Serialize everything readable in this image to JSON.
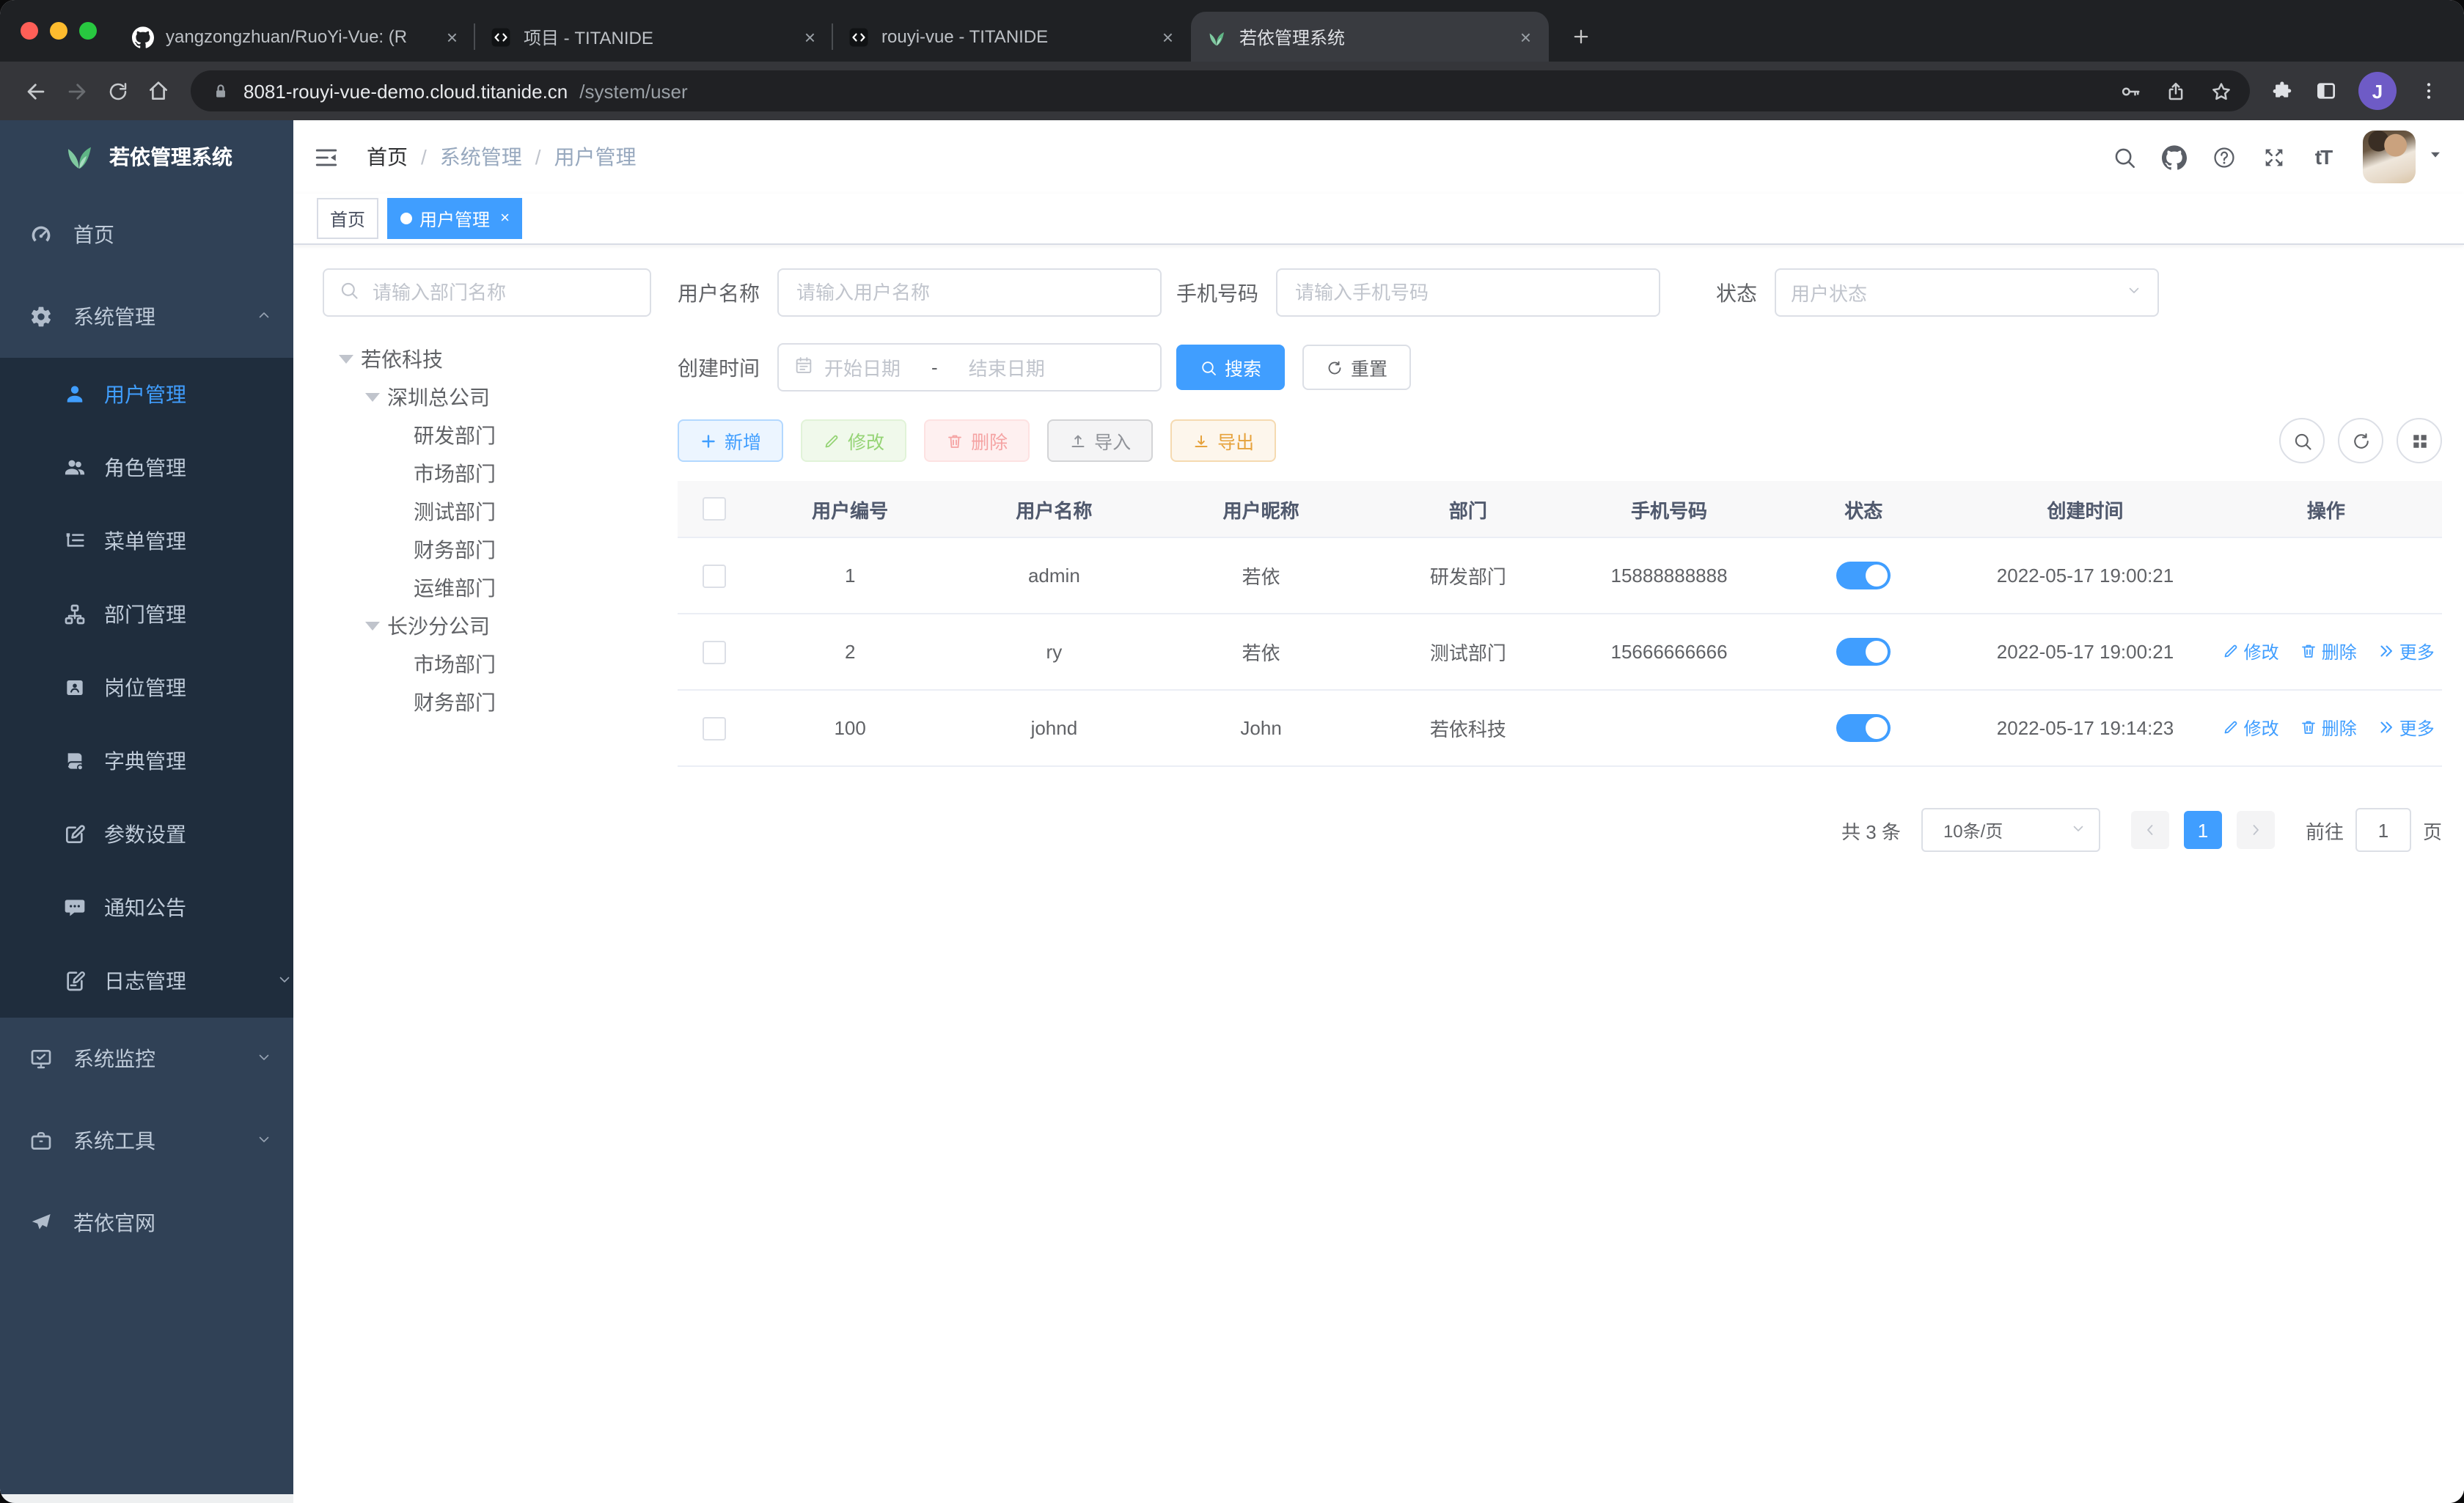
{
  "window": {
    "traffic_lights": [
      "#ff5f57",
      "#febc2e",
      "#28c840"
    ]
  },
  "browser": {
    "tabs": [
      {
        "title": "yangzongzhuan/RuoYi-Vue: (R",
        "icon": "github",
        "active": false
      },
      {
        "title": "项目 - TITANIDE",
        "icon": "code",
        "active": false
      },
      {
        "title": "rouyi-vue - TITANIDE",
        "icon": "code",
        "active": false
      },
      {
        "title": "若依管理系统",
        "icon": "leaf",
        "active": true
      }
    ],
    "url": {
      "host": "8081-rouyi-vue-demo.cloud.titanide.cn",
      "path": "/system/user"
    },
    "profile_initial": "J",
    "omnibox_icons": [
      "key",
      "share",
      "star"
    ],
    "toolbar_icons": [
      "puzzle",
      "side-panel",
      "kebab-menu"
    ]
  },
  "sidebar": {
    "logo_title": "若依管理系统",
    "menu": [
      {
        "label": "首页",
        "icon": "dashboard"
      },
      {
        "label": "系统管理",
        "icon": "gear",
        "state": "expanded",
        "children": [
          {
            "label": "用户管理",
            "icon": "user",
            "active": true
          },
          {
            "label": "角色管理",
            "icon": "users"
          },
          {
            "label": "菜单管理",
            "icon": "menu-tree"
          },
          {
            "label": "部门管理",
            "icon": "org-tree"
          },
          {
            "label": "岗位管理",
            "icon": "badge"
          },
          {
            "label": "字典管理",
            "icon": "dictionary"
          },
          {
            "label": "参数设置",
            "icon": "edit-square"
          },
          {
            "label": "通知公告",
            "icon": "message"
          },
          {
            "label": "日志管理",
            "icon": "log",
            "state": "collapsed"
          }
        ]
      },
      {
        "label": "系统监控",
        "icon": "monitor",
        "state": "collapsed"
      },
      {
        "label": "系统工具",
        "icon": "toolbox",
        "state": "collapsed"
      },
      {
        "label": "若依官网",
        "icon": "paper-plane"
      }
    ]
  },
  "navbar": {
    "breadcrumb": [
      "首页",
      "系统管理",
      "用户管理"
    ],
    "action_icons": [
      "search",
      "github",
      "question",
      "fullscreen",
      "text-size"
    ]
  },
  "tags": [
    {
      "label": "首页",
      "active": false,
      "closable": false
    },
    {
      "label": "用户管理",
      "active": true,
      "closable": true
    }
  ],
  "dept": {
    "search_placeholder": "请输入部门名称",
    "tree": [
      {
        "label": "若依科技",
        "expanded": true,
        "children": [
          {
            "label": "深圳总公司",
            "expanded": true,
            "children": [
              {
                "label": "研发部门"
              },
              {
                "label": "市场部门"
              },
              {
                "label": "测试部门"
              },
              {
                "label": "财务部门"
              },
              {
                "label": "运维部门"
              }
            ]
          },
          {
            "label": "长沙分公司",
            "expanded": true,
            "children": [
              {
                "label": "市场部门"
              },
              {
                "label": "财务部门"
              }
            ]
          }
        ]
      }
    ]
  },
  "filters": {
    "username_label": "用户名称",
    "username_placeholder": "请输入用户名称",
    "phone_label": "手机号码",
    "phone_placeholder": "请输入手机号码",
    "status_label": "状态",
    "status_placeholder": "用户状态",
    "created_label": "创建时间",
    "date_start_placeholder": "开始日期",
    "date_separator": "-",
    "date_end_placeholder": "结束日期",
    "search_button": "搜索",
    "reset_button": "重置"
  },
  "toolbar": {
    "buttons": [
      {
        "label": "新增",
        "icon": "plus",
        "type": "primary"
      },
      {
        "label": "修改",
        "icon": "pencil",
        "type": "success"
      },
      {
        "label": "删除",
        "icon": "trash",
        "type": "danger"
      },
      {
        "label": "导入",
        "icon": "upload",
        "type": "info"
      },
      {
        "label": "导出",
        "icon": "download",
        "type": "warning"
      }
    ],
    "right_icons": [
      "search",
      "refresh",
      "grid"
    ]
  },
  "table": {
    "columns": [
      "用户编号",
      "用户名称",
      "用户昵称",
      "部门",
      "手机号码",
      "状态",
      "创建时间",
      "操作"
    ],
    "rows": [
      {
        "id": "1",
        "username": "admin",
        "nickname": "若依",
        "dept": "研发部门",
        "phone": "15888888888",
        "status": true,
        "created": "2022-05-17 19:00:21",
        "actions": false
      },
      {
        "id": "2",
        "username": "ry",
        "nickname": "若依",
        "dept": "测试部门",
        "phone": "15666666666",
        "status": true,
        "created": "2022-05-17 19:00:21",
        "actions": true
      },
      {
        "id": "100",
        "username": "johnd",
        "nickname": "John",
        "dept": "若依科技",
        "phone": "",
        "status": true,
        "created": "2022-05-17 19:14:23",
        "actions": true
      }
    ],
    "row_actions": [
      {
        "label": "修改",
        "icon": "pencil"
      },
      {
        "label": "删除",
        "icon": "trash"
      },
      {
        "label": "更多",
        "icon": "double-arrow"
      }
    ]
  },
  "pagination": {
    "total": "共 3 条",
    "page_size": "10条/页",
    "current_page": "1",
    "goto_label": "前往",
    "goto_value": "1",
    "page_unit": "页"
  },
  "colors": {
    "primary": "#409eff",
    "sidebar_bg": "#304156",
    "submenu_bg": "#1f2d3d",
    "tag_active": "#409eff"
  }
}
